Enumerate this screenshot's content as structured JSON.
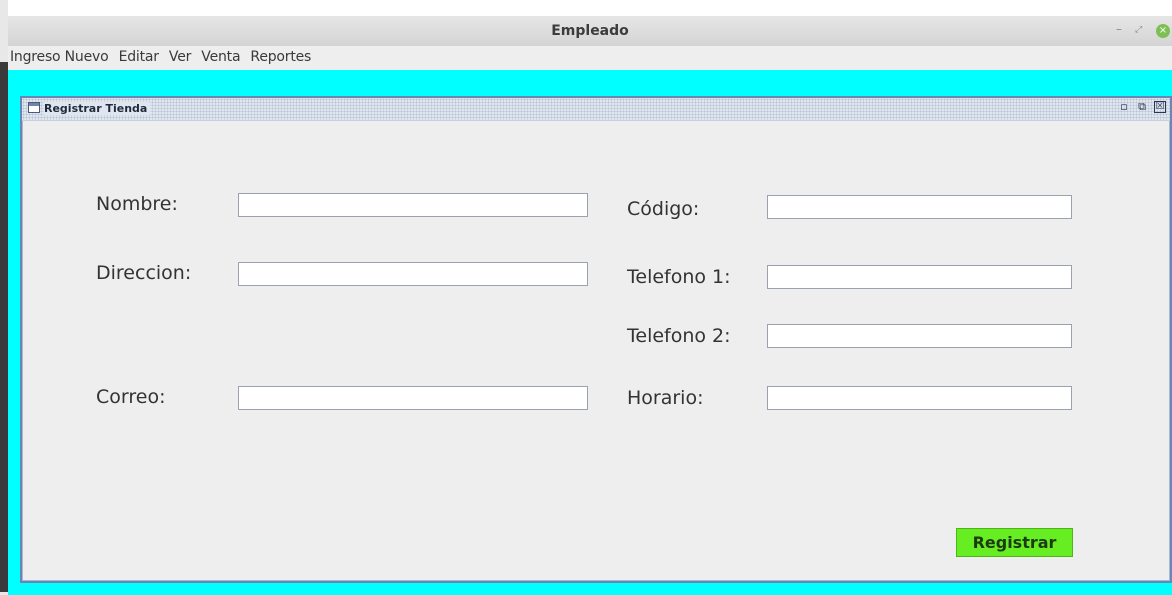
{
  "window": {
    "title": "Empleado",
    "controls": {
      "minimize": "–",
      "maximize": "⤢",
      "close": "×"
    }
  },
  "menubar": {
    "items": [
      "Ingreso Nuevo",
      "Editar",
      "Ver",
      "Venta",
      "Reportes"
    ]
  },
  "internal_frame": {
    "title": "Registrar Tienda",
    "icon": "window-icon",
    "controls": {
      "iconify": "▫",
      "maximize": "⧉",
      "close": "☒"
    }
  },
  "form": {
    "nombre": {
      "label": "Nombre:",
      "value": ""
    },
    "direccion": {
      "label": "Direccion:",
      "value": ""
    },
    "correo": {
      "label": "Correo:",
      "value": ""
    },
    "codigo": {
      "label": "Código:",
      "value": ""
    },
    "telefono1": {
      "label": "Telefono 1:",
      "value": ""
    },
    "telefono2": {
      "label": "Telefono 2:",
      "value": ""
    },
    "horario": {
      "label": "Horario:",
      "value": ""
    },
    "submit_label": "Registrar"
  },
  "colors": {
    "desktop_bg": "#00ffff",
    "frame_border": "#6b86b3",
    "button_bg": "#66ee22"
  }
}
